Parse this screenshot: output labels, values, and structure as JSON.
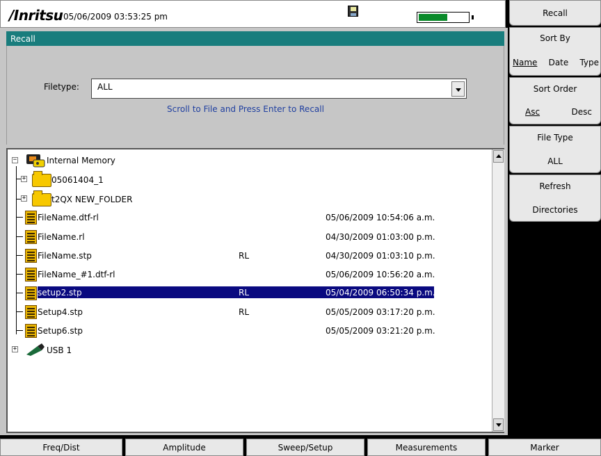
{
  "status_bar": {
    "brand": "/Inritsu",
    "datetime": "05/06/2009 03:53:25 pm",
    "battery_level": 0.6
  },
  "panel": {
    "title": "Recall",
    "filetype_label": "Filetype:",
    "filetype_value": "ALL",
    "hint": "Scroll to File and Press Enter to Recall"
  },
  "tree": {
    "root": "Internal Memory",
    "folders": [
      "05061404_1",
      "t2QX NEW_FOLDER"
    ],
    "files": [
      {
        "name": "FileName.dtf-rl",
        "type": "",
        "date": "05/06/2009 10:54:06 a.m."
      },
      {
        "name": "FileName.rl",
        "type": "",
        "date": "04/30/2009 01:03:00 p.m."
      },
      {
        "name": "FileName.stp",
        "type": "RL",
        "date": "04/30/2009 01:03:10 p.m."
      },
      {
        "name": "FileName_#1.dtf-rl",
        "type": "",
        "date": "05/06/2009 10:56:20 a.m."
      },
      {
        "name": "setup2.stp",
        "type": "RL",
        "date": "05/04/2009 06:50:34 p.m."
      },
      {
        "name": "Setup4.stp",
        "type": "RL",
        "date": "05/05/2009 03:17:20 p.m."
      },
      {
        "name": "Setup6.stp",
        "type": "",
        "date": "05/05/2009 03:21:20 p.m."
      }
    ],
    "selected_index": 4,
    "usb": "USB 1"
  },
  "softkeys": {
    "title": "Recall",
    "sort_by": {
      "label": "Sort By",
      "options": [
        "Name",
        "Date",
        "Type"
      ]
    },
    "sort_order": {
      "label": "Sort Order",
      "options": [
        "Asc",
        "Desc"
      ]
    },
    "file_type": {
      "label": "File Type",
      "value": "ALL"
    },
    "refresh": {
      "label": "Refresh",
      "sub": "Directories"
    }
  },
  "bottom_menu": [
    "Freq/Dist",
    "Amplitude",
    "Sweep/Setup",
    "Measurements",
    "Marker"
  ]
}
